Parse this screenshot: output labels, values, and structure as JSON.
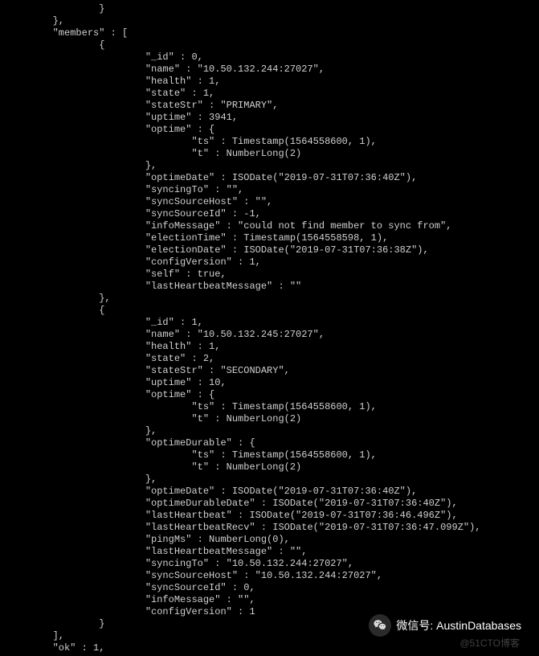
{
  "lines": [
    "                }",
    "        },",
    "        \"members\" : [",
    "                {",
    "                        \"_id\" : 0,",
    "                        \"name\" : \"10.50.132.244:27027\",",
    "                        \"health\" : 1,",
    "                        \"state\" : 1,",
    "                        \"stateStr\" : \"PRIMARY\",",
    "                        \"uptime\" : 3941,",
    "                        \"optime\" : {",
    "                                \"ts\" : Timestamp(1564558600, 1),",
    "                                \"t\" : NumberLong(2)",
    "                        },",
    "                        \"optimeDate\" : ISODate(\"2019-07-31T07:36:40Z\"),",
    "                        \"syncingTo\" : \"\",",
    "                        \"syncSourceHost\" : \"\",",
    "                        \"syncSourceId\" : -1,",
    "                        \"infoMessage\" : \"could not find member to sync from\",",
    "                        \"electionTime\" : Timestamp(1564558598, 1),",
    "                        \"electionDate\" : ISODate(\"2019-07-31T07:36:38Z\"),",
    "                        \"configVersion\" : 1,",
    "                        \"self\" : true,",
    "                        \"lastHeartbeatMessage\" : \"\"",
    "                },",
    "                {",
    "                        \"_id\" : 1,",
    "                        \"name\" : \"10.50.132.245:27027\",",
    "                        \"health\" : 1,",
    "                        \"state\" : 2,",
    "                        \"stateStr\" : \"SECONDARY\",",
    "                        \"uptime\" : 10,",
    "                        \"optime\" : {",
    "                                \"ts\" : Timestamp(1564558600, 1),",
    "                                \"t\" : NumberLong(2)",
    "                        },",
    "                        \"optimeDurable\" : {",
    "                                \"ts\" : Timestamp(1564558600, 1),",
    "                                \"t\" : NumberLong(2)",
    "                        },",
    "                        \"optimeDate\" : ISODate(\"2019-07-31T07:36:40Z\"),",
    "                        \"optimeDurableDate\" : ISODate(\"2019-07-31T07:36:40Z\"),",
    "                        \"lastHeartbeat\" : ISODate(\"2019-07-31T07:36:46.496Z\"),",
    "                        \"lastHeartbeatRecv\" : ISODate(\"2019-07-31T07:36:47.099Z\"),",
    "                        \"pingMs\" : NumberLong(0),",
    "                        \"lastHeartbeatMessage\" : \"\",",
    "                        \"syncingTo\" : \"10.50.132.244:27027\",",
    "                        \"syncSourceHost\" : \"10.50.132.244:27027\",",
    "                        \"syncSourceId\" : 0,",
    "                        \"infoMessage\" : \"\",",
    "                        \"configVersion\" : 1",
    "                }",
    "        ],",
    "        \"ok\" : 1,"
  ],
  "wechat": {
    "label": "微信号: AustinDatabases"
  },
  "watermark": {
    "text": "@51CTO博客"
  }
}
